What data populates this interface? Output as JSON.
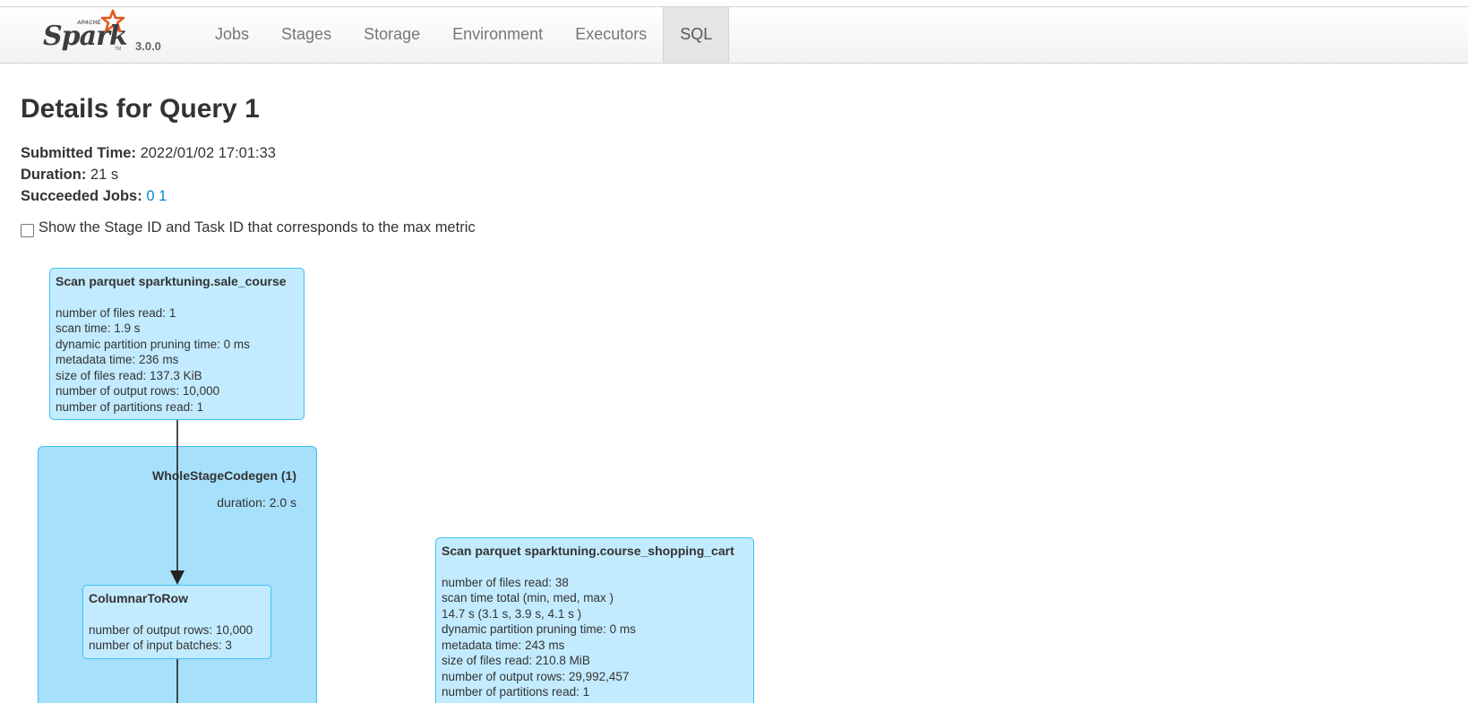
{
  "brand": {
    "apache": "APACHE",
    "name": "Spark",
    "tm": "TM",
    "version": "3.0.0"
  },
  "nav": [
    {
      "label": "Jobs"
    },
    {
      "label": "Stages"
    },
    {
      "label": "Storage"
    },
    {
      "label": "Environment"
    },
    {
      "label": "Executors"
    },
    {
      "label": "SQL",
      "active": true
    }
  ],
  "page": {
    "title": "Details for Query 1",
    "submitted_label": "Submitted Time:",
    "submitted_value": "2022/01/02 17:01:33",
    "duration_label": "Duration:",
    "duration_value": "21 s",
    "jobs_label": "Succeeded Jobs:",
    "jobs": [
      "0",
      "1"
    ],
    "toggle_label": "Show the Stage ID and Task ID that corresponds to the max metric"
  },
  "plan": {
    "cluster": {
      "title": "WholeStageCodegen (1)",
      "metric": "duration: 2.0 s"
    },
    "scan_sale_course": {
      "title": "Scan parquet sparktuning.sale_course",
      "metrics": [
        "number of files read: 1",
        "scan time: 1.9 s",
        "dynamic partition pruning time: 0 ms",
        "metadata time: 236 ms",
        "size of files read: 137.3 KiB",
        "number of output rows: 10,000",
        "number of partitions read: 1"
      ]
    },
    "columnar_to_row": {
      "title": "ColumnarToRow",
      "metrics": [
        "number of output rows: 10,000",
        "number of input batches: 3"
      ]
    },
    "scan_shopping_cart": {
      "title": "Scan parquet sparktuning.course_shopping_cart",
      "metrics": [
        "number of files read: 38",
        "scan time total (min, med, max )",
        "14.7 s (3.1 s, 3.9 s, 4.1 s )",
        "dynamic partition pruning time: 0 ms",
        "metadata time: 243 ms",
        "size of files read: 210.8 MiB",
        "number of output rows: 29,992,457",
        "number of partitions read: 1"
      ]
    }
  },
  "colors": {
    "link": "#0088cc",
    "node_fill": "#c3ebff",
    "cluster_fill": "#a7e0fb",
    "border": "#3ec0f5"
  }
}
